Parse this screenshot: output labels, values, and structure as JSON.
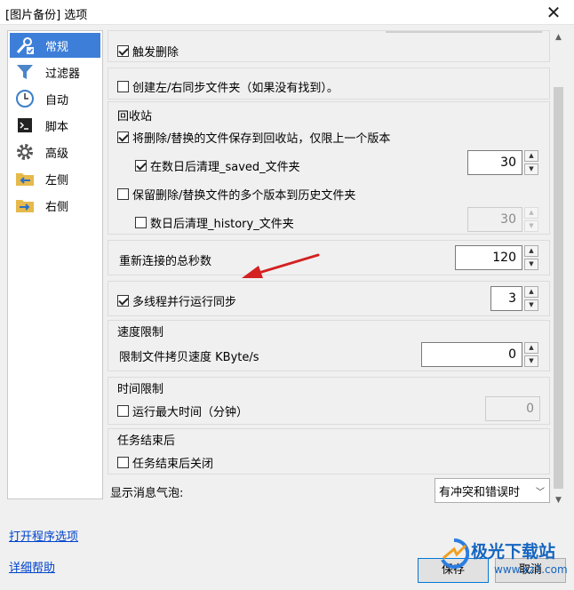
{
  "window": {
    "title": "[图片备份] 选项"
  },
  "sidebar": {
    "items": [
      {
        "label": "常规",
        "icon": "general-settings-icon",
        "active": true
      },
      {
        "label": "过滤器",
        "icon": "filter-icon"
      },
      {
        "label": "自动",
        "icon": "clock-icon"
      },
      {
        "label": "脚本",
        "icon": "script-icon"
      },
      {
        "label": "高级",
        "icon": "gear-icon"
      },
      {
        "label": "左侧",
        "icon": "folder-left-icon"
      },
      {
        "label": "右侧",
        "icon": "folder-right-icon"
      }
    ]
  },
  "settings": {
    "trigger_delete": {
      "label": "触发删除",
      "checked": true
    },
    "create_sync_folder": {
      "label": "创建左/右同步文件夹（如果没有找到）。",
      "checked": false
    },
    "recycle": {
      "title": "回收站",
      "save_to_recycle": {
        "label": "将删除/替换的文件保存到回收站，仅限上一个版本",
        "checked": true
      },
      "clean_saved": {
        "label": "在数日后清理_saved_文件夹",
        "checked": true,
        "value": "30"
      },
      "keep_history": {
        "label": "保留删除/替换文件的多个版本到历史文件夹",
        "checked": false
      },
      "clean_history": {
        "label": "数日后清理_history_文件夹",
        "checked": false,
        "value": "30"
      }
    },
    "reconnect": {
      "label": "重新连接的总秒数",
      "value": "120"
    },
    "multithread": {
      "label": "多线程并行运行同步",
      "checked": true,
      "value": "3"
    },
    "speed": {
      "title": "速度限制",
      "limit_label": "限制文件拷贝速度 KByte/s",
      "value": "0"
    },
    "time": {
      "title": "时间限制",
      "max_time": {
        "label": "运行最大时间（分钟）",
        "checked": false,
        "value": "0"
      }
    },
    "task_end": {
      "title": "任务结束后",
      "close": {
        "label": "任务结束后关闭",
        "checked": false
      }
    },
    "balloon": {
      "label": "显示消息气泡:",
      "value": "有冲突和错误时"
    }
  },
  "footer": {
    "open_program_options": "打开程序选项",
    "help": "详细帮助",
    "save": "保存",
    "cancel": "取消"
  },
  "watermark": {
    "text": "极光下载站",
    "url": "www.xz7.com"
  },
  "colors": {
    "accent": "#3d7fd8",
    "link": "#0044cc",
    "annotation_arrow": "#d42020"
  }
}
